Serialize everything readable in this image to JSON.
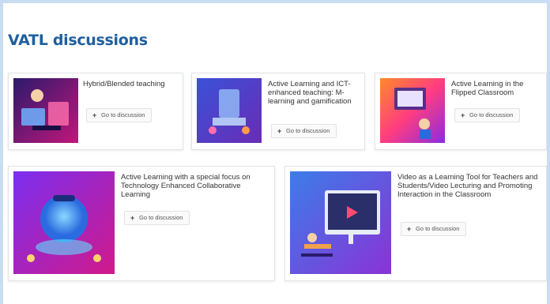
{
  "page": {
    "title": "VATL discussions"
  },
  "colors": {
    "title": "#1f5f9e",
    "background": "#c9dcf2"
  },
  "cards": [
    {
      "title": "Hybrid/Blended teaching",
      "button_label": "Go to discussion",
      "button_icon": "plus-icon"
    },
    {
      "title": "Active Learning and ICT-enhanced teaching: M-learning and gamification",
      "button_label": "Go to discussion",
      "button_icon": "plus-icon"
    },
    {
      "title": "Active Learning in the Flipped Classroom",
      "button_label": "Go to discussion",
      "button_icon": "plus-icon"
    },
    {
      "title": "Active Learning with a special focus on Technology Enhanced Collaborative Learning",
      "button_label": "Go to discussion",
      "button_icon": "plus-icon"
    },
    {
      "title": "Video as a Learning Tool for Teachers and Students/Video Lecturing and Promoting Interaction in the Classroom",
      "button_label": "Go to discussion",
      "button_icon": "plus-icon"
    }
  ]
}
